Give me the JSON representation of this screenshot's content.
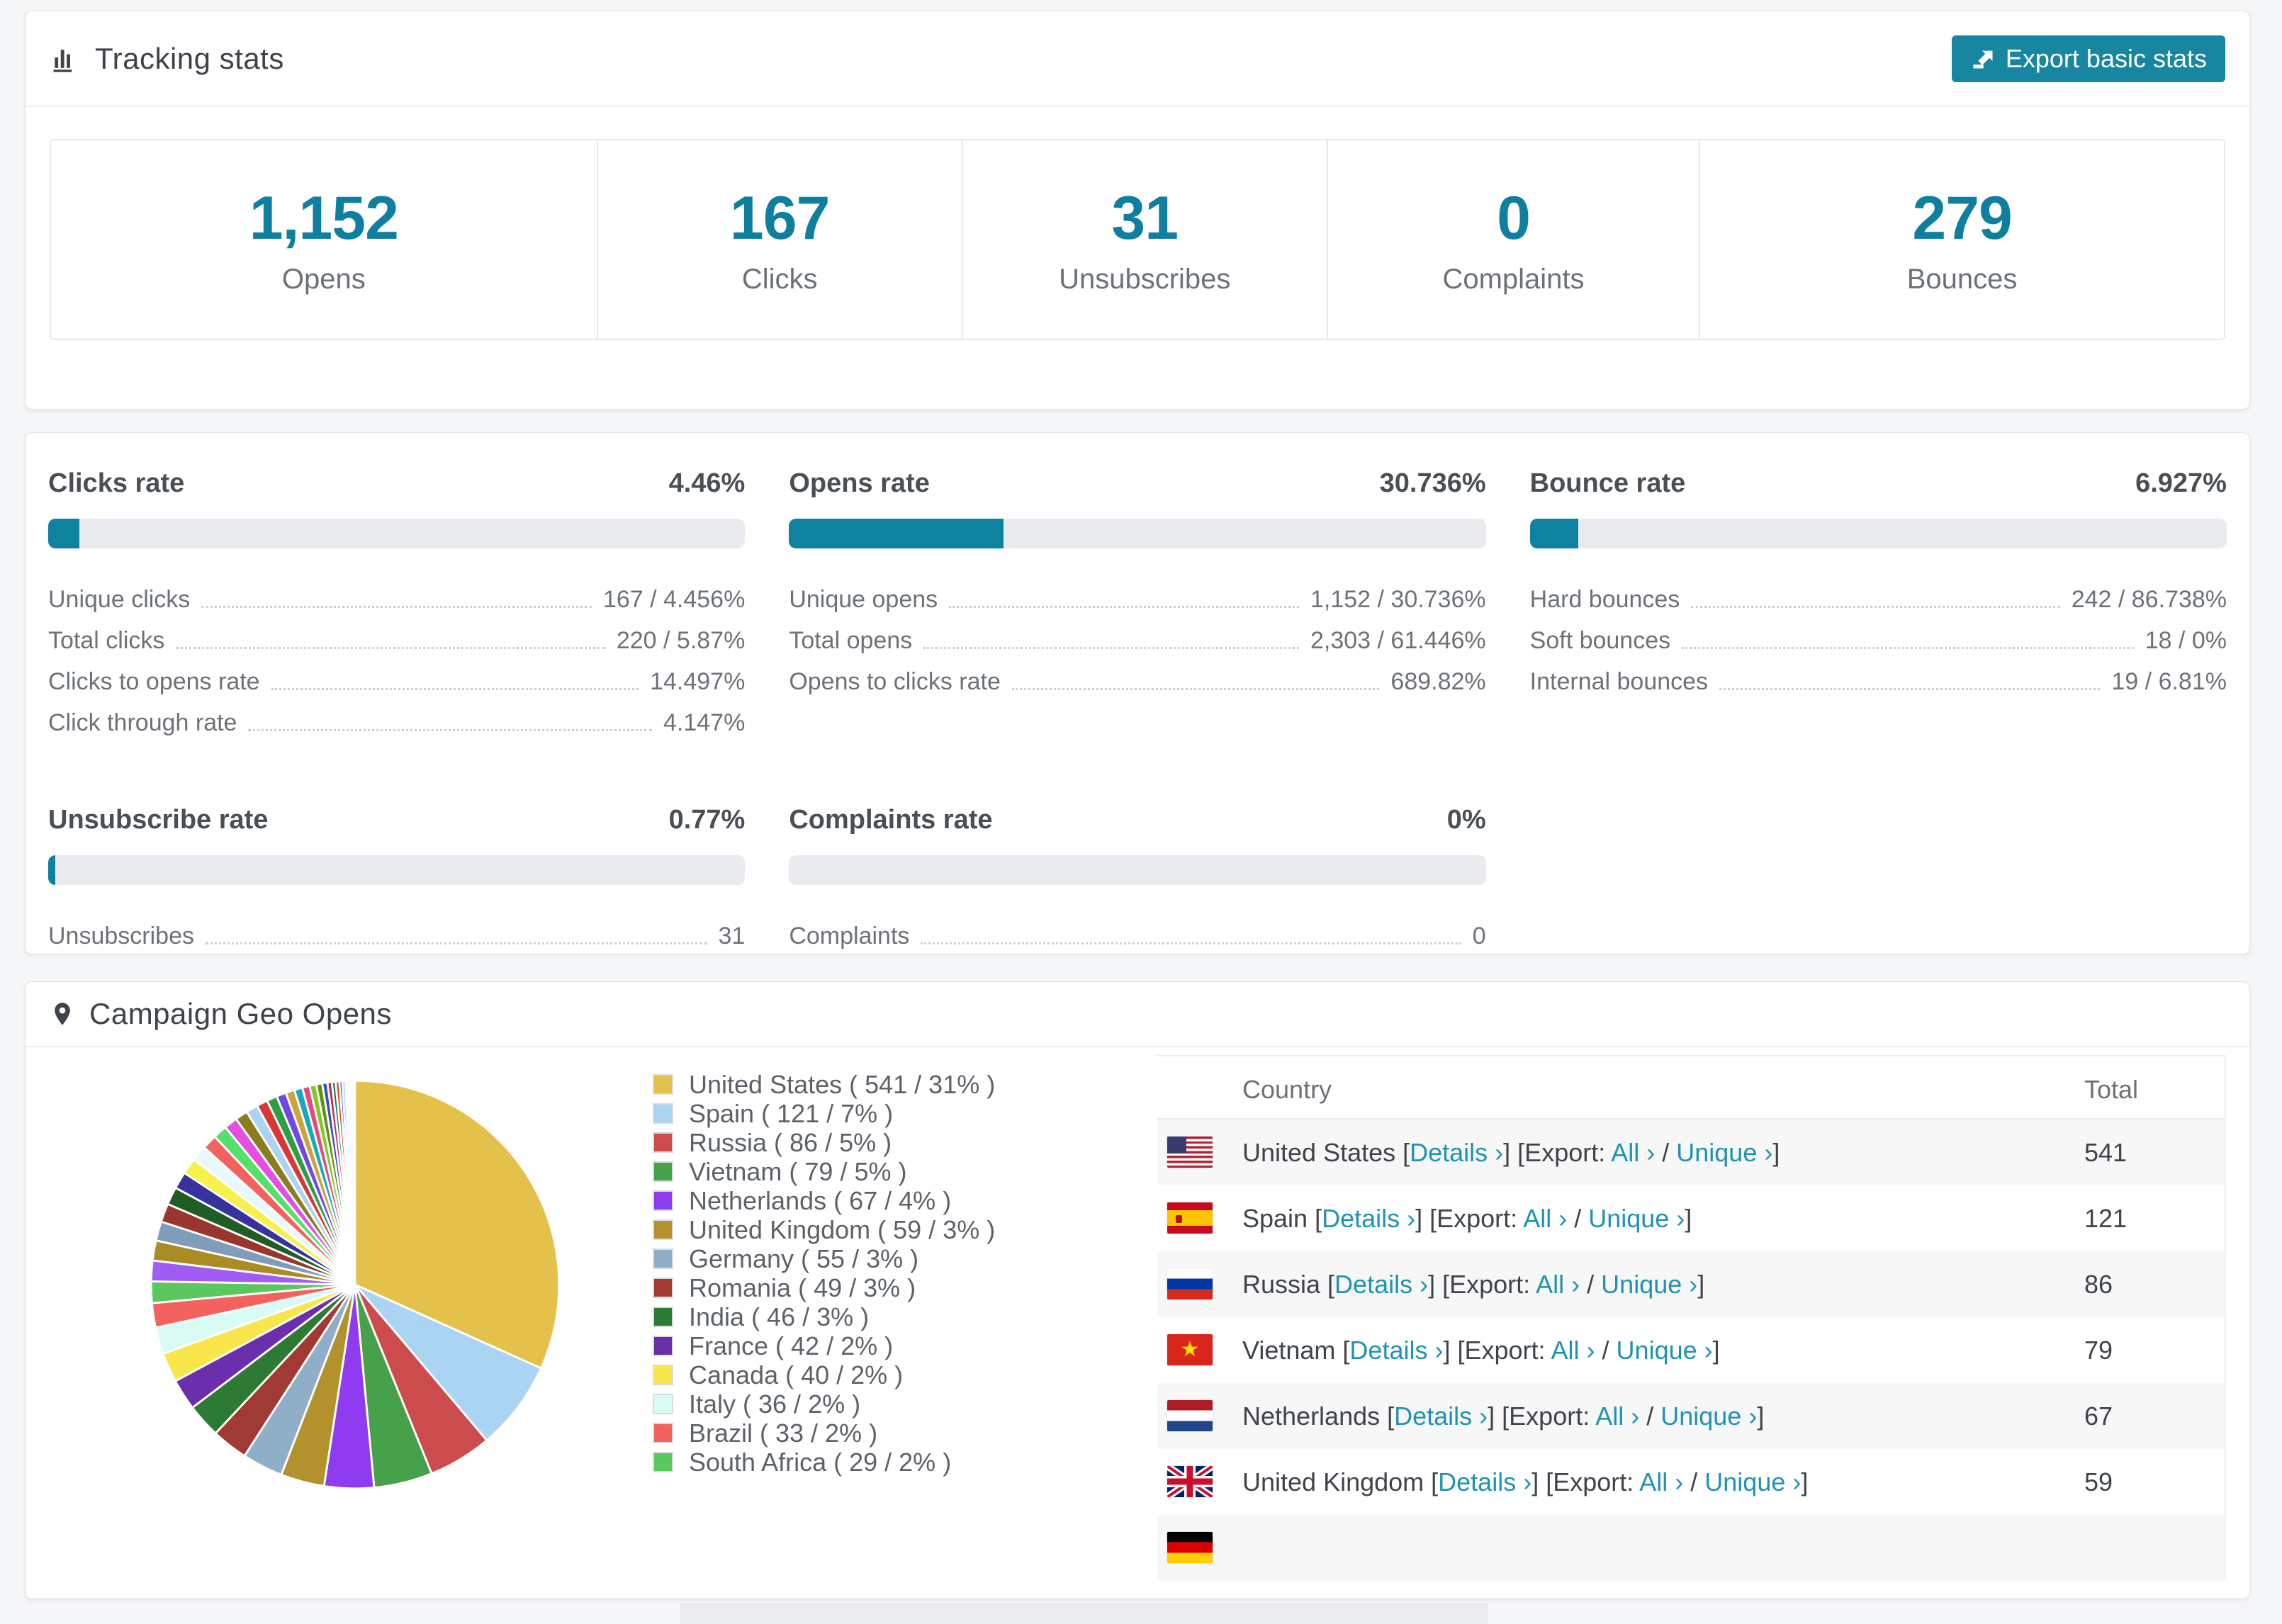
{
  "accent": "#1786a0",
  "tracking": {
    "title": "Tracking stats",
    "export_button": "Export basic stats",
    "stats": [
      {
        "value": "1,152",
        "label": "Opens"
      },
      {
        "value": "167",
        "label": "Clicks"
      },
      {
        "value": "31",
        "label": "Unsubscribes"
      },
      {
        "value": "0",
        "label": "Complaints"
      },
      {
        "value": "279",
        "label": "Bounces"
      }
    ]
  },
  "rates": [
    {
      "title": "Clicks rate",
      "value": "4.46%",
      "bar_percent": 4.46,
      "rows": [
        {
          "label": "Unique clicks",
          "value": "167 / 4.456%"
        },
        {
          "label": "Total clicks",
          "value": "220 / 5.87%"
        },
        {
          "label": "Clicks to opens rate",
          "value": "14.497%"
        },
        {
          "label": "Click through rate",
          "value": "4.147%"
        }
      ]
    },
    {
      "title": "Opens rate",
      "value": "30.736%",
      "bar_percent": 30.736,
      "rows": [
        {
          "label": "Unique opens",
          "value": "1,152 / 30.736%"
        },
        {
          "label": "Total opens",
          "value": "2,303 / 61.446%"
        },
        {
          "label": "Opens to clicks rate",
          "value": "689.82%"
        }
      ]
    },
    {
      "title": "Bounce rate",
      "value": "6.927%",
      "bar_percent": 6.927,
      "rows": [
        {
          "label": "Hard bounces",
          "value": "242 / 86.738%"
        },
        {
          "label": "Soft bounces",
          "value": "18 / 0%"
        },
        {
          "label": "Internal bounces",
          "value": "19 / 6.81%"
        }
      ]
    },
    {
      "title": "Unsubscribe rate",
      "value": "0.77%",
      "bar_percent": 0.77,
      "rows": [
        {
          "label": "Unsubscribes",
          "value": "31"
        }
      ]
    },
    {
      "title": "Complaints rate",
      "value": "0%",
      "bar_percent": 0,
      "rows": [
        {
          "label": "Complaints",
          "value": "0"
        }
      ]
    }
  ],
  "geo": {
    "title": "Campaign Geo Opens",
    "legend": [
      {
        "label": "United States ( 541 / 31% )",
        "color": "#e4c14b"
      },
      {
        "label": "Spain ( 121 / 7% )",
        "color": "#abd3f2"
      },
      {
        "label": "Russia ( 86 / 5% )",
        "color": "#cc4b4c"
      },
      {
        "label": "Vietnam ( 79 / 5% )",
        "color": "#46a14a"
      },
      {
        "label": "Netherlands ( 67 / 4% )",
        "color": "#8f3cf0"
      },
      {
        "label": "United Kingdom ( 59 / 3% )",
        "color": "#b3912c"
      },
      {
        "label": "Germany ( 55 / 3% )",
        "color": "#8fafc9"
      },
      {
        "label": "Romania ( 49 / 3% )",
        "color": "#a03a33"
      },
      {
        "label": "India ( 46 / 3% )",
        "color": "#2c7a33"
      },
      {
        "label": "France ( 42 / 2% )",
        "color": "#6b2fae"
      },
      {
        "label": "Canada ( 40 / 2% )",
        "color": "#f9e64d"
      },
      {
        "label": "Italy ( 36 / 2% )",
        "color": "#d8fbf4"
      },
      {
        "label": "Brazil ( 33 / 2% )",
        "color": "#f4625f"
      },
      {
        "label": "South Africa ( 29 / 2% )",
        "color": "#5bc85f"
      }
    ],
    "table": {
      "columns": {
        "country": "Country",
        "total": "Total"
      },
      "details_label": "Details ›",
      "export_prefix": "Export:",
      "all_label": "All ›",
      "unique_label": "Unique ›",
      "rows": [
        {
          "flag": "us",
          "country": "United States",
          "total": "541"
        },
        {
          "flag": "es",
          "country": "Spain",
          "total": "121"
        },
        {
          "flag": "ru",
          "country": "Russia",
          "total": "86"
        },
        {
          "flag": "vn",
          "country": "Vietnam",
          "total": "79"
        },
        {
          "flag": "nl",
          "country": "Netherlands",
          "total": "67"
        },
        {
          "flag": "gb",
          "country": "United Kingdom",
          "total": "59"
        },
        {
          "flag": "de",
          "country": "",
          "total": ""
        }
      ]
    }
  },
  "chart_data": {
    "type": "pie",
    "title": "Campaign Geo Opens",
    "labels": [
      "United States",
      "Spain",
      "Russia",
      "Vietnam",
      "Netherlands",
      "United Kingdom",
      "Germany",
      "Romania",
      "India",
      "France",
      "Canada",
      "Italy",
      "Brazil",
      "South Africa"
    ],
    "values": [
      541,
      121,
      86,
      79,
      67,
      59,
      55,
      49,
      46,
      42,
      40,
      36,
      33,
      29
    ],
    "percent_labels": [
      "31%",
      "7%",
      "5%",
      "5%",
      "4%",
      "3%",
      "3%",
      "3%",
      "3%",
      "2%",
      "2%",
      "2%",
      "2%",
      "2%"
    ],
    "colors": [
      "#e4c14b",
      "#abd3f2",
      "#cc4b4c",
      "#46a14a",
      "#8f3cf0",
      "#b3912c",
      "#8fafc9",
      "#a03a33",
      "#2c7a33",
      "#6b2fae",
      "#f9e64d",
      "#d8fbf4",
      "#f4625f",
      "#5bc85f"
    ],
    "legend_position": "right",
    "start_angle_deg": -90,
    "unlabeled_tail_values": [
      28,
      27,
      26,
      25,
      24,
      23,
      22,
      21,
      20,
      19,
      18,
      17,
      16,
      15,
      14,
      13,
      12,
      11,
      10,
      9,
      8,
      7,
      6,
      5,
      5,
      4,
      4,
      3,
      3,
      2,
      2,
      1,
      1,
      1
    ],
    "unlabeled_tail_colors": [
      "#a05cf5",
      "#ab8c24",
      "#7f9db8",
      "#98362f",
      "#205c26",
      "#37329e",
      "#f5f04a",
      "#e8f8fe",
      "#f4625f",
      "#55e06a",
      "#e44fe0",
      "#8a7d1f",
      "#abd3f2",
      "#d93636",
      "#2f9e44",
      "#7048e8",
      "#caa53d",
      "#15aabf",
      "#e64980",
      "#82c91e",
      "#5c940d",
      "#364fc7",
      "#c2255c",
      "#087f5b",
      "#d9480f",
      "#5f3dc4",
      "#66d9e8",
      "#ffd43b",
      "#ff8787",
      "#69db7c",
      "#da77f2",
      "#74c0fc",
      "#1098ad",
      "#e8590c"
    ]
  }
}
